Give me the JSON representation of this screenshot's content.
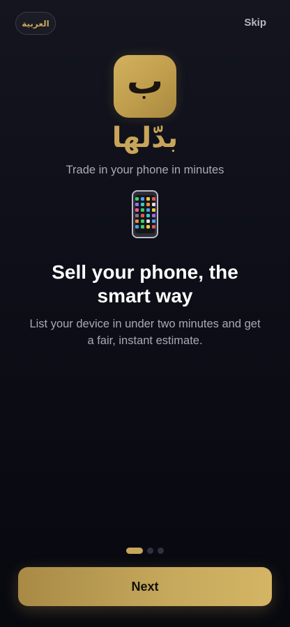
{
  "header": {
    "language_label": "العربية",
    "skip_label": "Skip"
  },
  "brand": {
    "app_icon_glyph": "ب",
    "wordmark": "بدّلها",
    "tagline": "Trade in your phone in minutes"
  },
  "illustration": {
    "icon": "mobile-phone-icon"
  },
  "slide": {
    "title": "Sell your phone, the smart way",
    "description": "List your device in under two minutes and get a fair, instant estimate."
  },
  "pager": {
    "total": 3,
    "current": 1
  },
  "footer": {
    "next_label": "Next"
  },
  "colors": {
    "accent": "#c9a558",
    "background": "#0d0e17",
    "text_primary": "#ffffff",
    "text_secondary": "#a9abbb"
  }
}
